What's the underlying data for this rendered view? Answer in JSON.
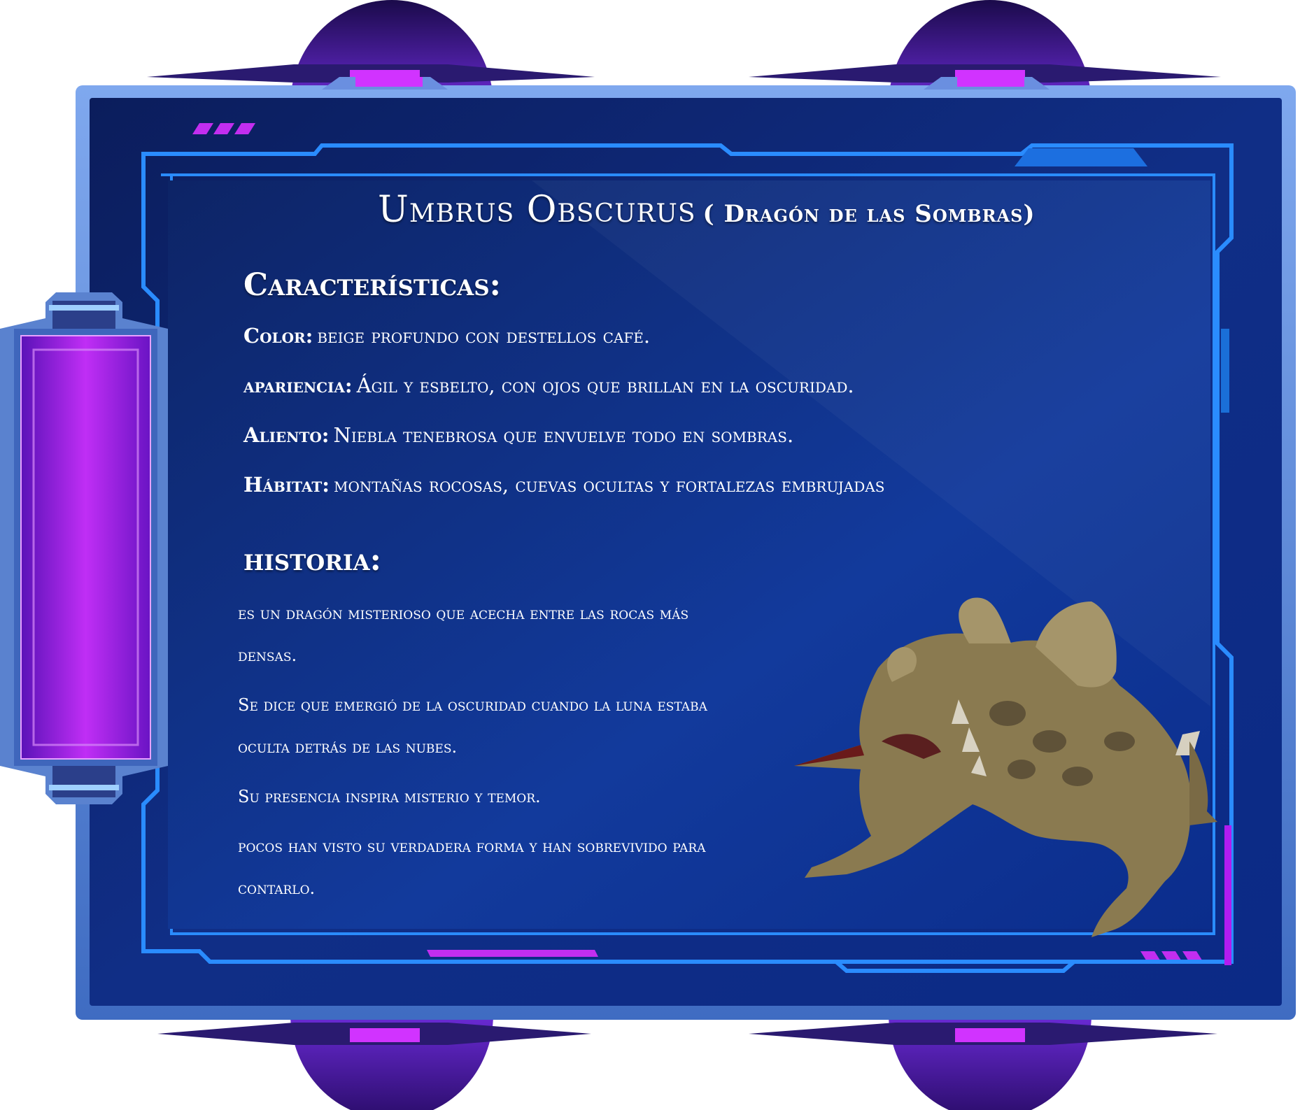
{
  "title": {
    "main": "Umbrus Obscurus",
    "sub": "( Dragón de las Sombras)"
  },
  "caracteristicas": {
    "heading": "Características:",
    "rows": [
      {
        "label": "Color:",
        "value": "beige profundo con destellos café."
      },
      {
        "label": "apariencia:",
        "value": "Ágil y esbelto, con ojos que brillan en la oscuridad."
      },
      {
        "label": "Aliento:",
        "value": "Niebla tenebrosa que envuelve todo en sombras."
      },
      {
        "label": "Hábitat:",
        "value": "montañas rocosas, cuevas ocultas y fortalezas embrujadas"
      }
    ]
  },
  "historia": {
    "heading": "historia:",
    "lines": [
      " es un dragón misterioso que acecha entre las rocas más",
      "densas.",
      " Se dice que emergió de la oscuridad cuando la luna estaba",
      "oculta detrás de las nubes.",
      " Su presencia inspira misterio y temor.",
      " pocos han visto su verdadera forma y han sobrevivido para",
      "contarlo."
    ]
  },
  "colors": {
    "panel": "#0d2570",
    "frame": "#5f8cd8",
    "neon_blue": "#2a8cff",
    "neon_purple": "#b21cf0"
  },
  "image": {
    "subject": "dragon-creature",
    "description": "beige lizard-like dragon with open mouth"
  }
}
